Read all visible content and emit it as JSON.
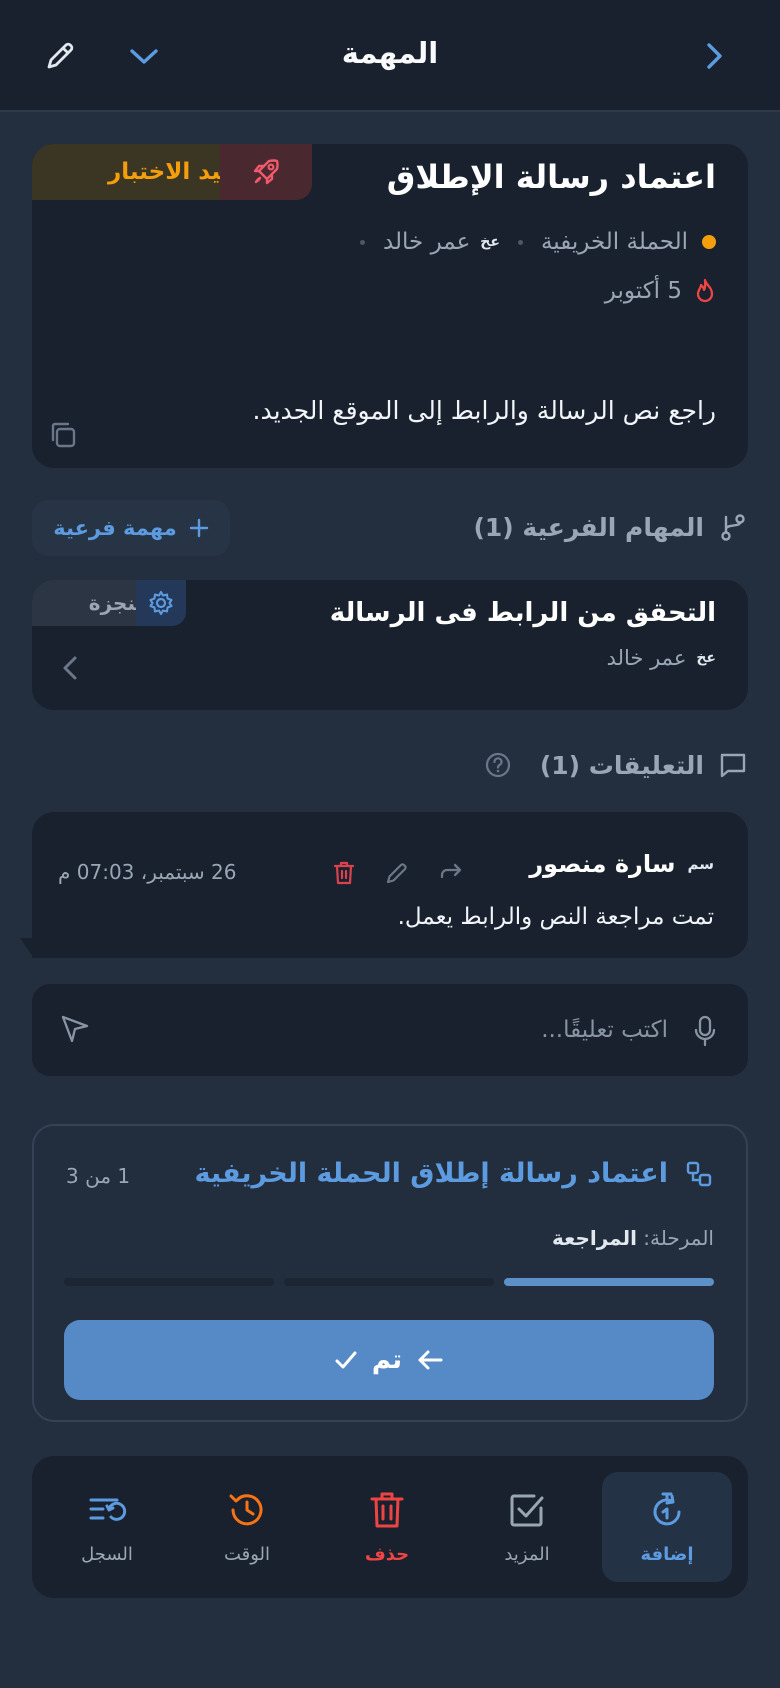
{
  "header": {
    "title": "المهمة"
  },
  "task": {
    "title": "اعتماد رسالة الإطلاق",
    "status": "قيد الاختبار",
    "project": "الحملة الخريفية",
    "assignee_initials": "عخ",
    "assignee": "عمر خالد",
    "due": "5 أكتوبر",
    "description": "راجع نص الرسالة والرابط إلى الموقع الجديد."
  },
  "subtasks": {
    "heading": "المهام الفرعية (1)",
    "add_label": "مهمة فرعية",
    "items": [
      {
        "title": "التحقق من الرابط فى الرسالة",
        "assignee_initials": "عخ",
        "assignee": "عمر خالد",
        "status": "منجزة"
      }
    ]
  },
  "comments": {
    "heading": "التعليقات (1)",
    "items": [
      {
        "author_initials": "سم",
        "author": "سارة منصور",
        "time": "26 سبتمبر، 07:03 م",
        "text": "تمت مراجعة النص والرابط يعمل."
      }
    ],
    "input_placeholder": "اكتب تعليقًا..."
  },
  "workflow": {
    "title": "اعتماد رسالة إطلاق الحملة الخريفية",
    "count": "1 من 3",
    "stage_label": "المرحلة:",
    "stage_value": "المراجعة",
    "progress": {
      "current": 1,
      "total": 3
    },
    "button_label": "تم"
  },
  "toolbar": {
    "items": [
      {
        "label": "إضافة",
        "icon": "timer-add-icon"
      },
      {
        "label": "المزيد",
        "icon": "checkbox-icon"
      },
      {
        "label": "حذف",
        "icon": "trash-icon"
      },
      {
        "label": "الوقت",
        "icon": "history-icon"
      },
      {
        "label": "السجل",
        "icon": "log-icon"
      }
    ]
  },
  "colors": {
    "accent": "#5d9be0",
    "warning": "#f59e0b",
    "danger": "#ef4444",
    "history": "#f97316"
  }
}
